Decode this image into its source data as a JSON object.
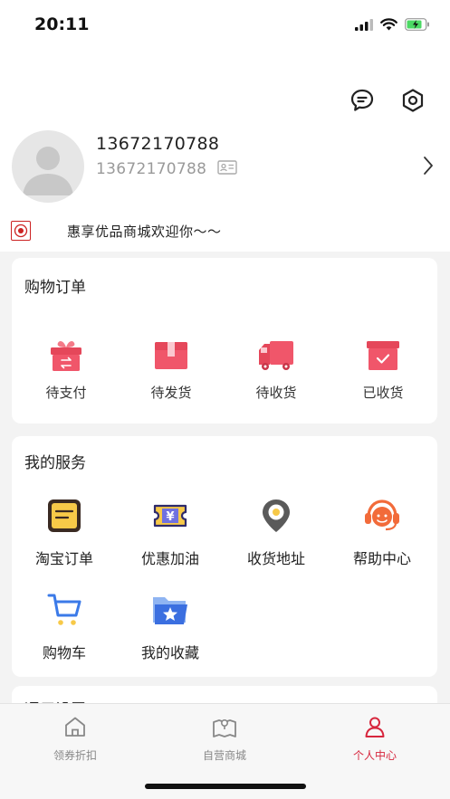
{
  "status_bar": {
    "time": "20:11"
  },
  "profile": {
    "username": "13672170788",
    "phone": "13672170788",
    "welcome": "惠享优品商城欢迎你～～"
  },
  "orders": {
    "title": "购物订单",
    "items": [
      {
        "label": "待支付",
        "icon": "gift-box-icon"
      },
      {
        "label": "待发货",
        "icon": "package-icon"
      },
      {
        "label": "待收货",
        "icon": "truck-icon"
      },
      {
        "label": "已收货",
        "icon": "received-box-icon"
      }
    ]
  },
  "services": {
    "title": "我的服务",
    "items": [
      {
        "label": "淘宝订单",
        "icon": "order-list-icon"
      },
      {
        "label": "优惠加油",
        "icon": "fuel-coupon-icon"
      },
      {
        "label": "收货地址",
        "icon": "location-pin-icon"
      },
      {
        "label": "帮助中心",
        "icon": "headset-icon"
      },
      {
        "label": "购物车",
        "icon": "cart-icon"
      },
      {
        "label": "我的收藏",
        "icon": "favorites-folder-icon"
      }
    ]
  },
  "partial_section": {
    "title": "通用设置"
  },
  "tab_bar": {
    "tabs": [
      {
        "label": "领券折扣",
        "icon": "home-icon",
        "active": false
      },
      {
        "label": "自营商城",
        "icon": "map-icon",
        "active": false
      },
      {
        "label": "个人中心",
        "icon": "person-icon",
        "active": true
      }
    ]
  },
  "colors": {
    "accent": "#d7263d",
    "icon_pink": "#f0566a",
    "tab_inactive": "#888888"
  }
}
